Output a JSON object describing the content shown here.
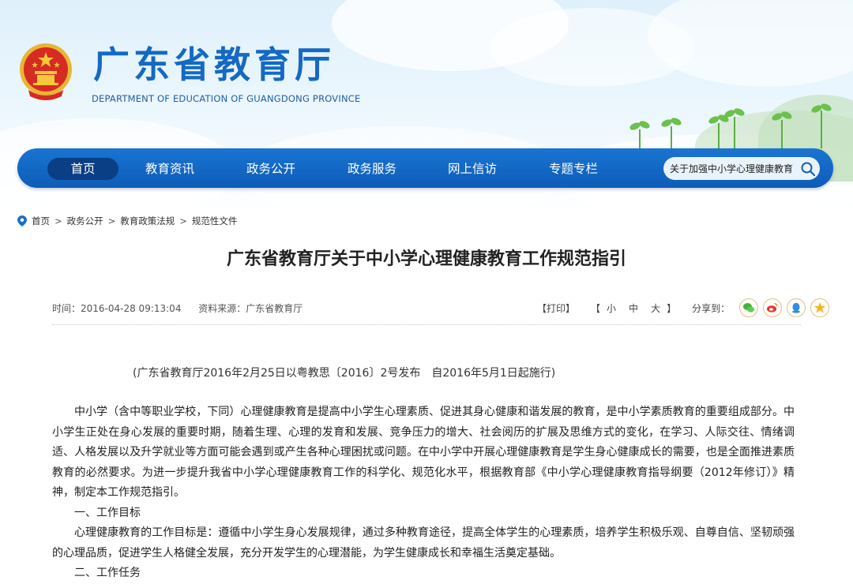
{
  "site": {
    "title": "广东省教育厅",
    "subtitle": "DEPARTMENT OF EDUCATION OF GUANGDONG PROVINCE"
  },
  "nav": {
    "items": [
      "首页",
      "教育资讯",
      "政务公开",
      "政务服务",
      "网上信访",
      "专题专栏"
    ],
    "active": "首页"
  },
  "search": {
    "value": "关于加强中小学心理健康教育"
  },
  "breadcrumb": [
    "首页",
    "政务公开",
    "教育政策法规",
    "规范性文件"
  ],
  "article": {
    "title": "广东省教育厅关于中小学心理健康教育工作规范指引",
    "time": "时间：2016-04-28 09:13:04",
    "source": "资料来源：广东省教育厅",
    "publish_note": "(广东省教育厅2016年2月25日以粤教思〔2016〕2号发布　自2016年5月1日起施行)",
    "paragraphs": [
      "中小学（含中等职业学校，下同）心理健康教育是提高中小学生心理素质、促进其身心健康和谐发展的教育，是中小学素质教育的重要组成部分。中小学生正处在身心发展的重要时期，随着生理、心理的发育和发展、竞争压力的增大、社会阅历的扩展及思维方式的变化，在学习、人际交往、情绪调适、人格发展以及升学就业等方面可能会遇到或产生各种心理困扰或问题。在中小学中开展心理健康教育是学生身心健康成长的需要，也是全面推进素质教育的必然要求。为进一步提升我省中小学心理健康教育工作的科学化、规范化水平，根据教育部《中小学心理健康教育指导纲要（2012年修订）》精神，制定本工作规范指引。",
      "一、工作目标",
      "心理健康教育的工作目标是：遵循中小学生身心发展规律，通过多种教育途径，提高全体学生的心理素质，培养学生积极乐观、自尊自信、坚韧顽强的心理品质，促进学生人格健全发展，充分开发学生的心理潜能，为学生健康成长和幸福生活奠定基础。",
      "二、工作任务"
    ]
  },
  "tools": {
    "print": "【打印】",
    "size_open": "【",
    "size_small": "小",
    "size_medium": "中",
    "size_large": "大",
    "size_close": "】",
    "share_label": "分享到："
  },
  "share_icons": [
    "wechat-icon",
    "weibo-icon",
    "qq-icon",
    "qzone-star-icon"
  ],
  "colors": {
    "nav_bg": "#1469c3",
    "nav_active": "#0a3f86",
    "title_blue": "#1469c3"
  }
}
